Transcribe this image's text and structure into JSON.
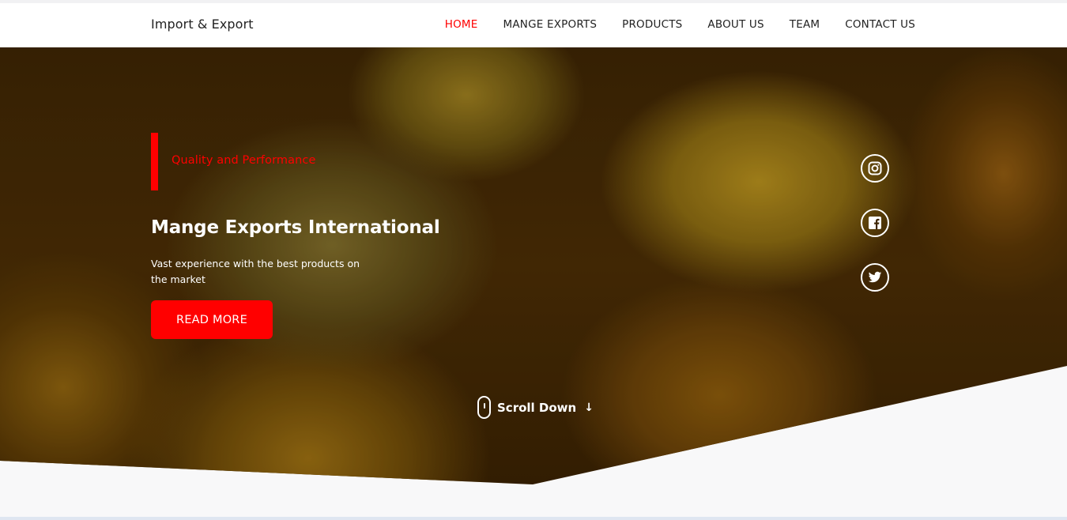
{
  "brand": "Import & Export",
  "nav": {
    "items": [
      {
        "label": "HOME",
        "active": true
      },
      {
        "label": "MANGE EXPORTS",
        "active": false
      },
      {
        "label": "PRODUCTS",
        "active": false
      },
      {
        "label": "ABOUT US",
        "active": false
      },
      {
        "label": "TEAM",
        "active": false
      },
      {
        "label": "CONTACT US",
        "active": false
      }
    ]
  },
  "hero": {
    "eyebrow": "Quality and Performance",
    "title": "Mange Exports International",
    "text": "Vast experience with the best products on the market",
    "button_label": "READ MORE",
    "scroll_label": "Scroll Down"
  },
  "social": [
    {
      "icon": "instagram-icon"
    },
    {
      "icon": "facebook-icon"
    },
    {
      "icon": "twitter-icon"
    }
  ],
  "colors": {
    "accent": "#ff0000",
    "text_dark": "#222222",
    "white": "#ffffff"
  }
}
